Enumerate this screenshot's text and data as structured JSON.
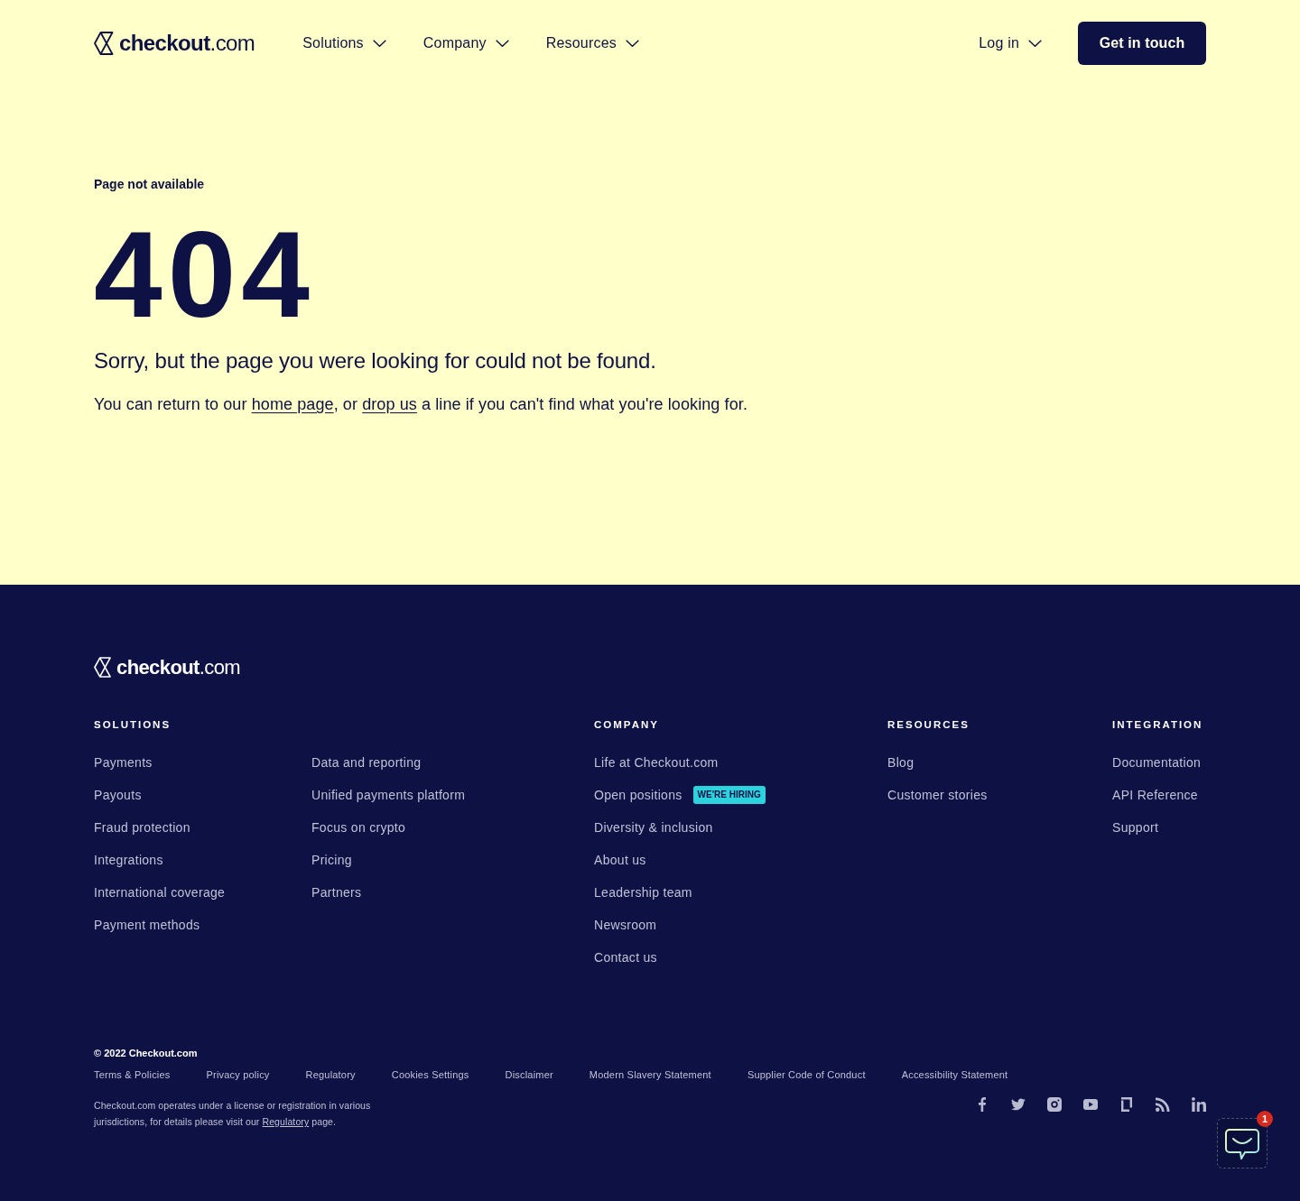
{
  "header": {
    "logo_text": "**checkout**.com",
    "nav": [
      {
        "label": "Solutions",
        "has_menu": true
      },
      {
        "label": "Company",
        "has_menu": true
      },
      {
        "label": "Resources",
        "has_menu": true
      }
    ],
    "login": {
      "label": "Log in",
      "has_menu": true
    },
    "cta": "Get in touch"
  },
  "main": {
    "eyebrow": "Page not available",
    "code": "404",
    "headline": "Sorry, but the page you were looking for could not be found.",
    "message": [
      {
        "kind": "text",
        "text": "You can return to our "
      },
      {
        "kind": "link",
        "text": "home page"
      },
      {
        "kind": "text",
        "text": ", or "
      },
      {
        "kind": "link",
        "text": "drop us"
      },
      {
        "kind": "text",
        "text": " a line if you can't find what you're looking for."
      }
    ]
  },
  "footer": {
    "logo_text": "**checkout**.com",
    "columns": [
      {
        "heading": "SOLUTIONS",
        "groups": [
          [
            {
              "label": "Payments"
            },
            {
              "label": "Payouts"
            },
            {
              "label": "Fraud protection"
            },
            {
              "label": "Integrations"
            },
            {
              "label": "International coverage"
            },
            {
              "label": "Payment methods"
            }
          ],
          [
            {
              "label": "Data and reporting"
            },
            {
              "label": "Unified payments platform"
            },
            {
              "label": "Focus on crypto"
            },
            {
              "label": "Pricing"
            },
            {
              "label": "Partners"
            }
          ]
        ]
      },
      {
        "heading": "COMPANY",
        "groups": [
          [
            {
              "label": "Life at Checkout.com"
            },
            {
              "label": "Open positions",
              "badge": "WE'RE HIRING"
            },
            {
              "label": "Diversity & inclusion"
            },
            {
              "label": "About us"
            },
            {
              "label": "Leadership team"
            },
            {
              "label": "Newsroom"
            },
            {
              "label": "Contact us"
            }
          ]
        ]
      },
      {
        "heading": "RESOURCES",
        "groups": [
          [
            {
              "label": "Blog"
            },
            {
              "label": "Customer stories"
            }
          ]
        ]
      },
      {
        "heading": "INTEGRATION",
        "groups": [
          [
            {
              "label": "Documentation"
            },
            {
              "label": "API Reference"
            },
            {
              "label": "Support"
            }
          ]
        ]
      }
    ],
    "copyright": "© 2022 Checkout.com",
    "legal_links": [
      "Terms & Policies",
      "Privacy policy",
      "Regulatory",
      "Cookies Settings",
      "Disclaimer",
      "Modern Slavery Statement",
      "Supplier Code of Conduct",
      "Accessibility Statement"
    ],
    "license_note": [
      {
        "kind": "text",
        "text": "Checkout.com operates under a license or registration in various jurisdictions, for details please visit our "
      },
      {
        "kind": "link",
        "text": "Regulatory"
      },
      {
        "kind": "text",
        "text": " page."
      }
    ]
  },
  "chat": {
    "unread": "1"
  }
}
